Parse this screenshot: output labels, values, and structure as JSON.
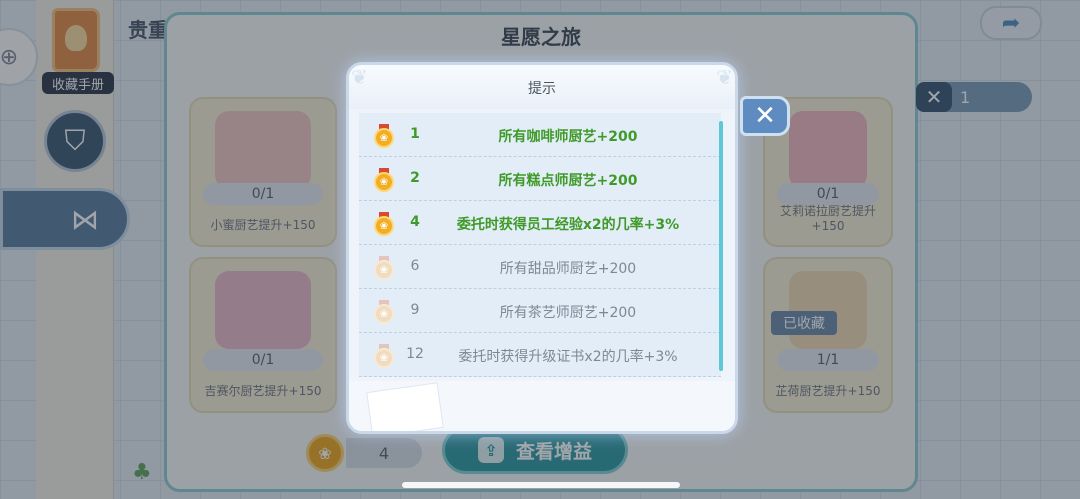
{
  "background": {
    "side_title": "贵重",
    "book_label": "收藏手册",
    "main_title": "星愿之旅",
    "tiles": [
      {
        "count": "0/1",
        "name": "小蜜厨艺提升+150"
      },
      {
        "count": "0/1",
        "name": "吉赛尔厨艺提升+150"
      },
      {
        "count": "0/1",
        "name": "艾莉诺拉厨艺提升+150"
      },
      {
        "count": "1/1",
        "name": "芷荷厨艺提升+150",
        "badge": "已收藏"
      }
    ],
    "right_counter": "1",
    "medal_count": "4",
    "view_gain_label": "查看增益"
  },
  "modal": {
    "title": "提示",
    "rows": [
      {
        "level": "1",
        "desc": "所有咖啡师厨艺+200",
        "active": true
      },
      {
        "level": "2",
        "desc": "所有糕点师厨艺+200",
        "active": true
      },
      {
        "level": "4",
        "desc": "委托时获得员工经验x2的几率+3%",
        "active": true
      },
      {
        "level": "6",
        "desc": "所有甜品师厨艺+200",
        "active": false
      },
      {
        "level": "9",
        "desc": "所有茶艺师厨艺+200",
        "active": false
      },
      {
        "level": "12",
        "desc": "委托时获得升级证书x2的几率+3%",
        "active": false
      }
    ]
  },
  "colors": {
    "active_text": "#3f9a2a",
    "inactive_text": "#7d8895",
    "accent": "#2f9aa0",
    "close_button": "#5f8cc0"
  },
  "icons": {
    "close": "close-icon",
    "medal": "medal-icon",
    "share": "share-icon",
    "book": "book-icon"
  }
}
